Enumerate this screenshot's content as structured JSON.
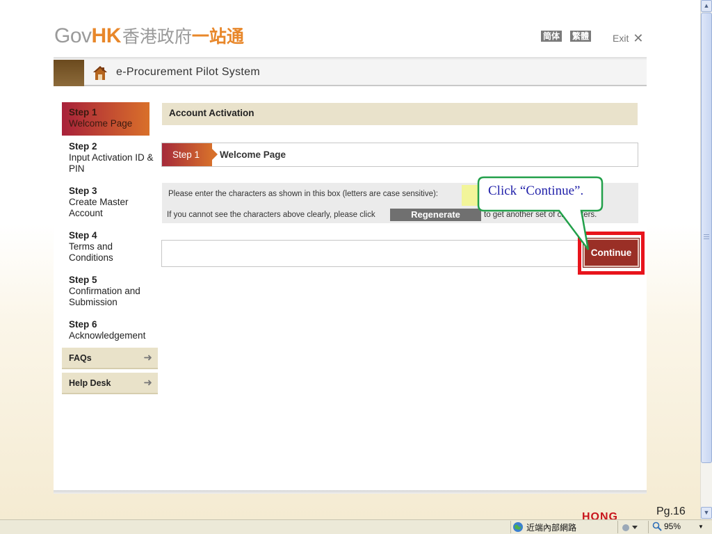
{
  "header": {
    "logo_gov": "Gov",
    "logo_hk": "HK",
    "logo_cn_grey": "香港政府",
    "logo_cn_orange": "一站通",
    "lang_simplified": "简体",
    "lang_traditional": "繁體",
    "exit_label": "Exit",
    "system_title": "e-Procurement Pilot System"
  },
  "sidebar": {
    "steps": [
      {
        "num": "Step 1",
        "label": "Welcome Page"
      },
      {
        "num": "Step 2",
        "label": "Input Activation ID & PIN"
      },
      {
        "num": "Step 3",
        "label": "Create Master Account"
      },
      {
        "num": "Step 4",
        "label": "Terms and Conditions"
      },
      {
        "num": "Step 5",
        "label": "Confirmation and Submission"
      },
      {
        "num": "Step 6",
        "label": "Acknowledgement"
      }
    ],
    "faqs_label": "FAQs",
    "helpdesk_label": "Help Desk"
  },
  "main": {
    "section_title": "Account Activation",
    "step_tag": "Step 1",
    "step_label": "Welcome Page",
    "captcha_prompt": "Please enter the characters as shown in this box (letters are case sensitive):",
    "captcha_hint_before": "If you cannot see the characters above clearly, please click",
    "regenerate_label": "Regenerate",
    "captcha_hint_after": "to get another set of characters.",
    "continue_label": "Continue"
  },
  "callout": {
    "text": "Click “Continue”."
  },
  "footer": {
    "hong_text": "HONG",
    "page_number": "Pg.16"
  },
  "statusbar": {
    "zone_label": "近端內部網路",
    "zoom_level": "95%"
  },
  "colors": {
    "accent_orange": "#e8872a",
    "step_gradient_start": "#a8213a",
    "step_gradient_end": "#d9702a",
    "section_beige": "#e9e2cb",
    "continue_button": "#9a2f26",
    "highlight_red": "#e8141c",
    "callout_green": "#22a04a"
  }
}
